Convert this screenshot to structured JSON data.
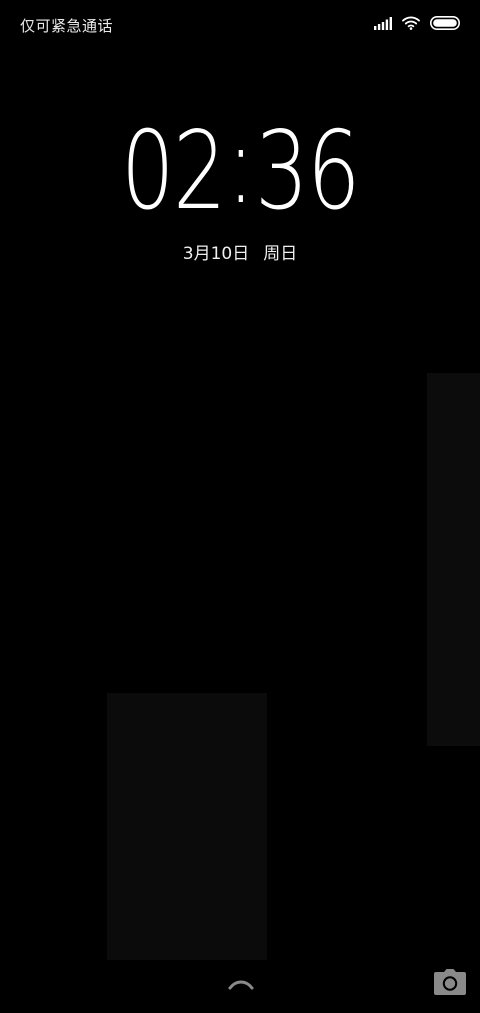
{
  "status_bar": {
    "carrier_text": "仅可紧急通话",
    "icons": [
      "signal-icon",
      "wifi-icon",
      "battery-icon"
    ]
  },
  "lockscreen": {
    "clock": {
      "hours": "02",
      "separator": ":",
      "minutes": "36"
    },
    "date": {
      "day": "3月10日",
      "weekday": "周日"
    }
  },
  "bottom_controls": {
    "unlock_icon": "chevron-up-icon",
    "camera_icon": "camera-icon"
  },
  "colors": {
    "background": "#000000",
    "text": "#ffffff",
    "icon_gray": "#8a8a8a",
    "panel": "#0c0c0c"
  }
}
